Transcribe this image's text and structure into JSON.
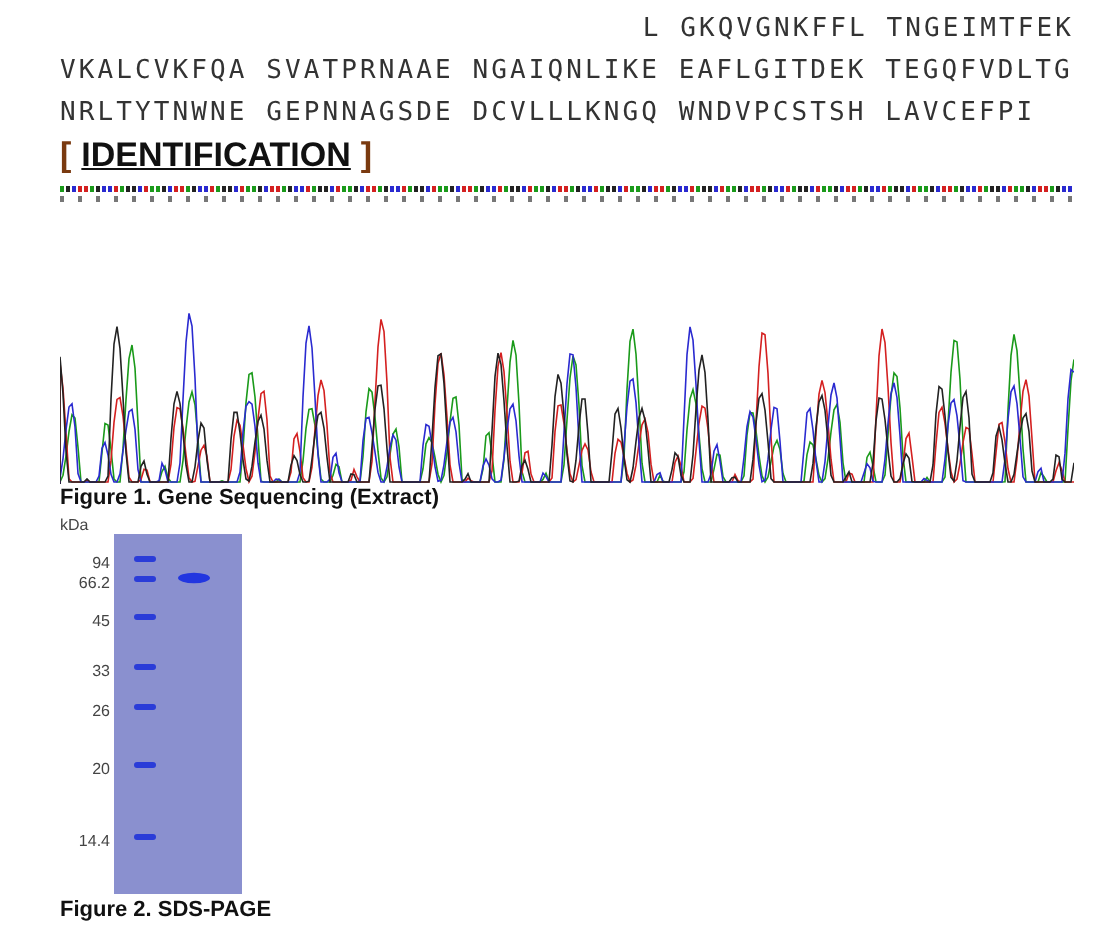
{
  "sequence": {
    "lines": [
      "L GKQVGNKFFL TNGEIMTFEK",
      "VKALCVKFQA SVATPRNAAE NGAIQNLIKE EAFLGITDEK TEGQFVDLTG",
      "NRLTYTNWNE GEPNNAGSDE DCVLLLKNGQ WNDVPCSTSH LAVCEFPI"
    ]
  },
  "identification": {
    "heading_open": "[",
    "heading": "IDENTIFICATION",
    "heading_close": "]"
  },
  "figure_1": {
    "caption": "Figure 1. Gene Sequencing (Extract)"
  },
  "figure_2": {
    "unit": "kDa",
    "marker_labels": [
      "94",
      "66.2",
      "45",
      "33",
      "26",
      "20",
      "14.4"
    ],
    "caption": "Figure 2. SDS-PAGE"
  }
}
